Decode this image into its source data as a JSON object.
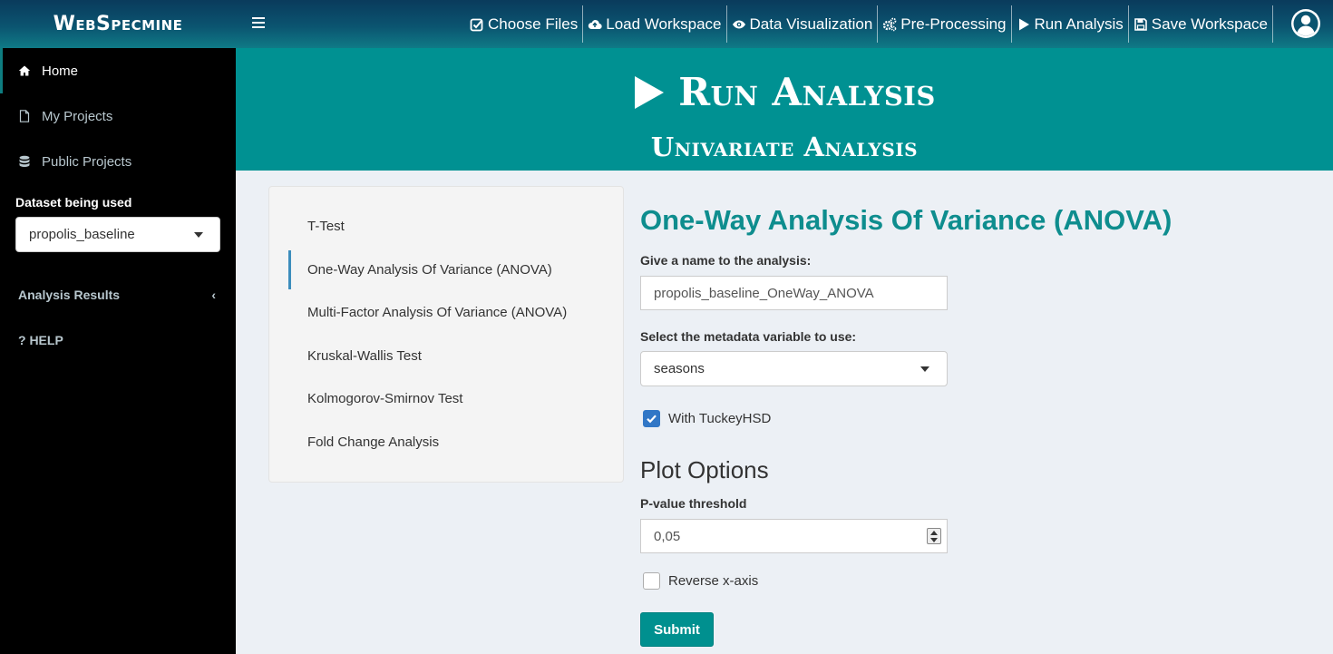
{
  "brand": "WebSpecmine",
  "topnav": {
    "items": [
      {
        "label": "Choose Files",
        "icon": "check-square-icon"
      },
      {
        "label": "Load Workspace",
        "icon": "cloud-upload-icon"
      },
      {
        "label": "Data Visualization",
        "icon": "eye-icon"
      },
      {
        "label": "Pre-Processing",
        "icon": "gears-icon"
      },
      {
        "label": "Run Analysis",
        "icon": "play-icon"
      },
      {
        "label": "Save Workspace",
        "icon": "floppy-disk-icon"
      }
    ]
  },
  "sidebar": {
    "items": [
      {
        "label": "Home",
        "icon": "home-icon"
      },
      {
        "label": "My Projects",
        "icon": "file-icon"
      },
      {
        "label": "Public Projects",
        "icon": "database-icon"
      }
    ],
    "dataset_label": "Dataset being used",
    "dataset_value": "propolis_baseline",
    "analysis_results": "Analysis Results",
    "help": "? HELP"
  },
  "banner": {
    "title": "Run Analysis",
    "subtitle": "Univariate Analysis"
  },
  "tabs": [
    "T-Test",
    "One-Way Analysis Of Variance (ANOVA)",
    "Multi-Factor Analysis Of Variance (ANOVA)",
    "Kruskal-Wallis Test",
    "Kolmogorov-Smirnov Test",
    "Fold Change Analysis"
  ],
  "form": {
    "title": "One-Way Analysis Of Variance (ANOVA)",
    "name_label": "Give a name to the analysis:",
    "name_value": "propolis_baseline_OneWay_ANOVA",
    "metadata_label": "Select the metadata variable to use:",
    "metadata_value": "seasons",
    "tukey_label": "With TuckeyHSD",
    "plot_options": "Plot Options",
    "pvalue_label": "P-value threshold",
    "pvalue_value": "0,05",
    "reverse_label": "Reverse x-axis",
    "submit_label": "Submit"
  },
  "colors": {
    "accent": "#009192",
    "active_tab_marker": "#3c8dbc",
    "checkbox": "#3177c6"
  }
}
